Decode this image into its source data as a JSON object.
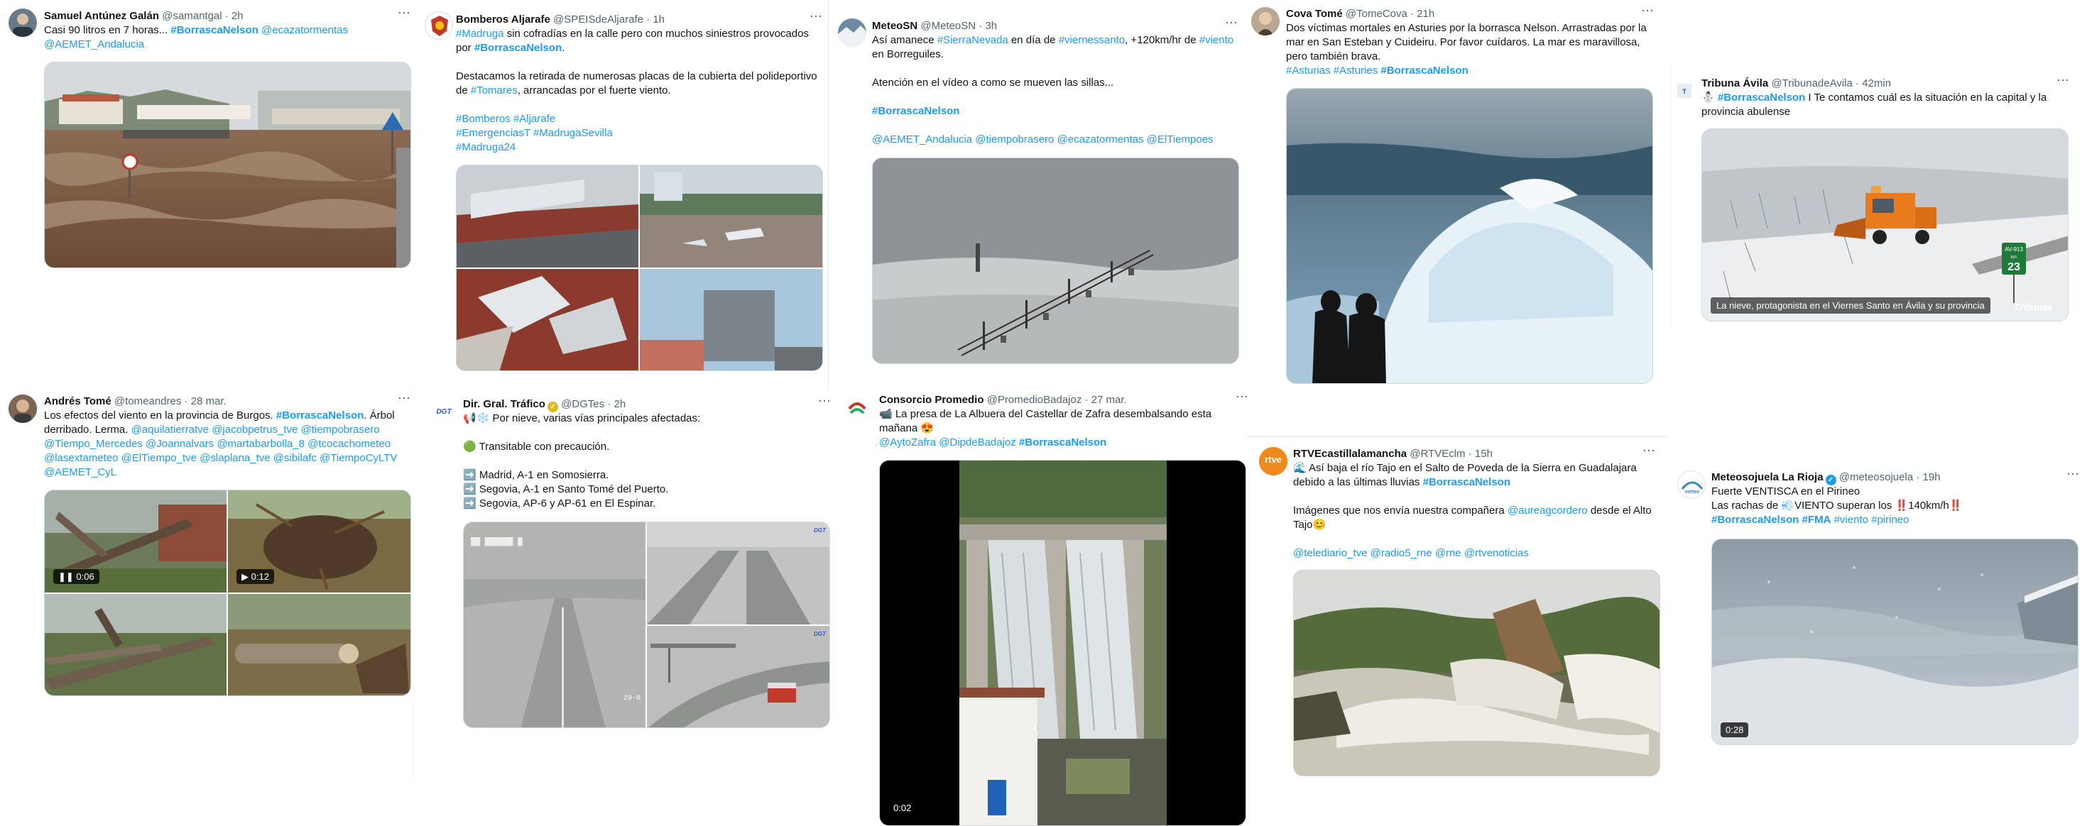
{
  "colors": {
    "link": "#1d9bf0",
    "handle": "#536471",
    "verified_blue": "#1d9bf0",
    "verified_gold": "#e2b719"
  },
  "more_icon": "⋯",
  "tweets": [
    {
      "name": "Samuel Antúnez Galán",
      "handle": "@samantgal",
      "time": "2h",
      "parts": [
        {
          "t": "Casi 90 litros en 7 horas... "
        },
        {
          "t": "#BorrascaNelson",
          "s": "lb"
        },
        {
          "t": " "
        },
        {
          "t": "@ecazatormentas",
          "s": "l"
        },
        {
          "t": "\n"
        },
        {
          "t": "@AEMET_Andalucia",
          "s": "l"
        }
      ]
    },
    {
      "name": "Bomberos Aljarafe",
      "handle": "@SPEISdeAljarafe",
      "time": "1h",
      "parts": [
        {
          "t": "#Madruga",
          "s": "l"
        },
        {
          "t": " sin cofradías en la calle pero con muchos siniestros provocados por "
        },
        {
          "t": "#BorrascaNelson",
          "s": "lb"
        },
        {
          "t": ".\n\nDestacamos la retirada de numerosas placas de la cubierta del polideportivo de "
        },
        {
          "t": "#Tomares",
          "s": "l"
        },
        {
          "t": ", arrancadas por el fuerte viento.\n\n"
        },
        {
          "t": "#Bomberos #Aljarafe\n#EmergenciasT #MadrugaSevilla\n#Madruga24",
          "s": "l"
        }
      ]
    },
    {
      "name": "MeteoSN",
      "handle": "@MeteoSN",
      "time": "3h",
      "parts": [
        {
          "t": "Así amanece "
        },
        {
          "t": "#SierraNevada",
          "s": "l"
        },
        {
          "t": " en día de "
        },
        {
          "t": "#viernessanto",
          "s": "l"
        },
        {
          "t": ", +120km/hr de "
        },
        {
          "t": "#viento",
          "s": "l"
        },
        {
          "t": " en Borreguiles.\n\nAtención en el vídeo a como se mueven las sillas...\n\n"
        },
        {
          "t": "#BorrascaNelson",
          "s": "lb"
        },
        {
          "t": "\n\n"
        },
        {
          "t": "@AEMET_Andalucia @tiempobrasero @ecazatormentas @ElTiempoes",
          "s": "l"
        }
      ]
    },
    {
      "name": "Cova Tomé",
      "handle": "@TomeCova",
      "time": "21h",
      "parts": [
        {
          "t": "Dos víctimas mortales en Asturies  por la borrasca Nelson. Arrastradas por la mar en San Esteban  y Cuideiru. Por favor cuídaros. La mar es maravillosa, pero también brava.\n"
        },
        {
          "t": "#Asturias #Asturies",
          "s": "l"
        },
        {
          "t": " "
        },
        {
          "t": "#BorrascaNelson",
          "s": "lb"
        }
      ]
    },
    {
      "name": "Tribuna Ávila",
      "handle": "@TribunadeAvila",
      "time": "42min",
      "parts": [
        {
          "t": "⛄ "
        },
        {
          "t": "#BorrascaNelson",
          "s": "lb"
        },
        {
          "t": " I Te contamos cuál es la situación en la capital y la provincia abulense"
        }
      ],
      "caption": "La nieve, protagonista en el Viernes Santo en Ávila y su provincia",
      "brand": "Tribuna",
      "road_sign": "AV-913",
      "road_km": "km",
      "road_num": "23"
    },
    {
      "name": "Andrés Tomé",
      "handle": "@tomeandres",
      "time": "28 mar.",
      "parts": [
        {
          "t": "Los efectos del viento en la provincia de Burgos. "
        },
        {
          "t": "#BorrascaNelson",
          "s": "lb"
        },
        {
          "t": ". Árbol derribado. Lerma. "
        },
        {
          "t": "@aquilatierratve @jacobpetrus_tve @tiempobrasero @Tiempo_Mercedes @Joannalvars @martabarbolla_8 @tcocachometeo @lasextameteo @ElTiempo_tve @slaplana_tve @sibilafc @TiempoCyLTV @AEMET_CyL",
          "s": "l"
        }
      ],
      "video1": "0:06",
      "video2": "0:12"
    },
    {
      "name": "Dir. Gral. Tráfico",
      "handle": "@DGTes",
      "time": "2h",
      "parts": [
        {
          "t": "📢❄️ Por nieve, varias vías principales afectadas:\n\n🟢 Transitable con precaución.\n\n➡️ Madrid, A-1 en Somosierra.\n➡️ Segovia, A-1 en Santo Tomé del Puerto.\n➡️ Segovia, AP-6 y AP-61 en El Espinar."
        }
      ]
    },
    {
      "name": "Consorcio Promedio",
      "handle": "@PromedioBadajoz",
      "time": "27 mar.",
      "parts": [
        {
          "t": "📹 La presa de La Albuera del Castellar de Zafra desembalsando esta mañana 😍\n"
        },
        {
          "t": "@AytoZafra @DipdeBadajoz",
          "s": "l"
        },
        {
          "t": " "
        },
        {
          "t": "#BorrascaNelson",
          "s": "lb"
        }
      ],
      "video": "0:02"
    },
    {
      "name": "RTVEcastillalamancha",
      "handle": "@RTVEclm",
      "time": "15h",
      "parts": [
        {
          "t": "🌊 Así baja el río Tajo en el Salto de Poveda de la Sierra en Guadalajara debido a las últimas lluvias "
        },
        {
          "t": "#BorrascaNelson",
          "s": "lb"
        },
        {
          "t": "\n\nImágenes que nos envía nuestra compañera "
        },
        {
          "t": "@aureagcordero",
          "s": "l"
        },
        {
          "t": " desde el Alto Tajo😊\n\n"
        },
        {
          "t": "@telediario_tve @radio5_rne @rne @rtvenoticias",
          "s": "l"
        }
      ],
      "logo": "rtve"
    },
    {
      "name": "Meteosojuela La Rioja",
      "handle": "@meteosojuela",
      "time": "19h",
      "parts": [
        {
          "t": "Fuerte VENTISCA en el Pirineo\nLas rachas de 💨VIENTO superan los ‼️140km/h‼️\n"
        },
        {
          "t": "#BorrascaNelson #FMA",
          "s": "lb"
        },
        {
          "t": "  "
        },
        {
          "t": "#viento #pirineo",
          "s": "l"
        }
      ],
      "video": "0:28"
    }
  ]
}
